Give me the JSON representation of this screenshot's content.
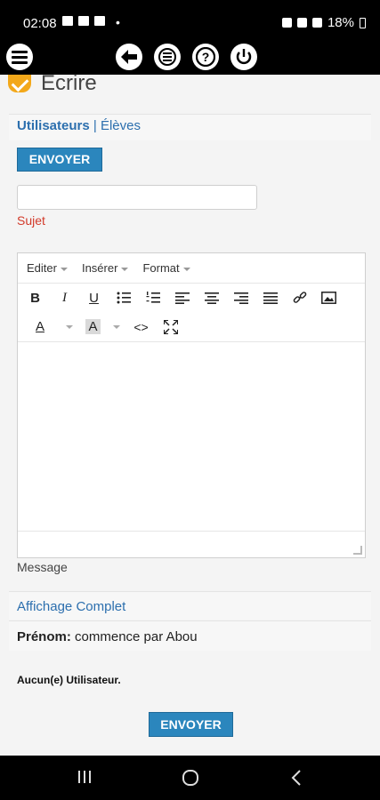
{
  "status_bar": {
    "time": "02:08",
    "dot": "•",
    "battery": "18%"
  },
  "app_bar": {
    "icons": [
      "menu-icon",
      "back-icon",
      "list-icon",
      "help-icon",
      "power-icon"
    ]
  },
  "header": {
    "title": "Ecrire"
  },
  "recipients": {
    "users_label": "Utilisateurs",
    "separator": "|",
    "students_label": "Élèves"
  },
  "send_top": {
    "label": "ENVOYER"
  },
  "subject": {
    "value": "",
    "label": "Sujet"
  },
  "editor": {
    "menus": [
      "Editer",
      "Insérer",
      "Format"
    ],
    "toolbar_row1": [
      "bold-icon",
      "italic-icon",
      "underline-icon",
      "bullet-list-icon",
      "numbered-list-icon",
      "align-left-icon",
      "align-center-icon",
      "align-right-icon",
      "justify-icon",
      "link-icon",
      "image-icon"
    ],
    "toolbar_row2": [
      "text-color-icon",
      "background-color-icon",
      "source-code-icon",
      "fullscreen-icon"
    ],
    "bold_glyph": "B",
    "italic_glyph": "I",
    "underline_glyph": "U",
    "color_glyph": "A",
    "code_glyph": "<>"
  },
  "message": {
    "label": "Message"
  },
  "display": {
    "full_label": "Affichage Complet"
  },
  "filter": {
    "label": "Prénom:",
    "value": "commence par Abou"
  },
  "result": {
    "text": "Aucun(e) Utilisateur."
  },
  "send_bottom": {
    "label": "ENVOYER"
  },
  "nav": [
    "recent-apps-icon",
    "home-icon",
    "back-nav-icon"
  ]
}
